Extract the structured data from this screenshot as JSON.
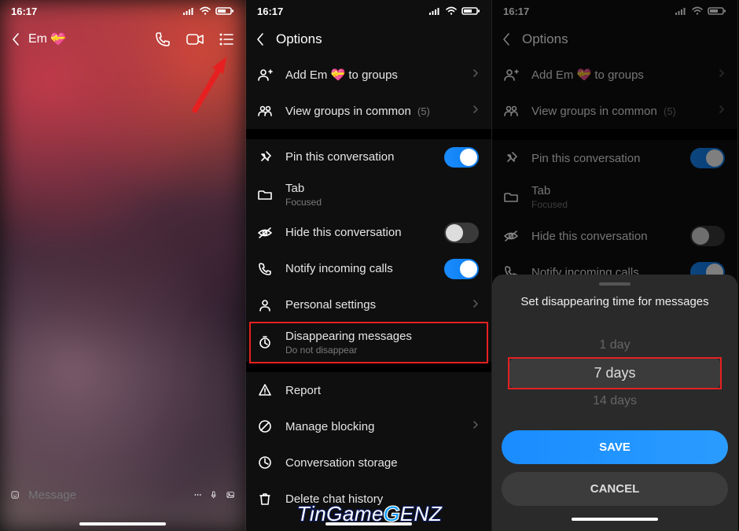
{
  "status": {
    "time": "16:17"
  },
  "chat": {
    "name": "Em",
    "emoji": "💝",
    "placeholder": "Message"
  },
  "options": {
    "title": "Options",
    "add_prefix": "Add ",
    "add_name": "Em",
    "add_emoji": "💝",
    "add_suffix": " to groups",
    "view_groups": "View groups in common",
    "view_groups_count": "(5)",
    "pin": "Pin this conversation",
    "tab": "Tab",
    "tab_sub": "Focused",
    "hide": "Hide this conversation",
    "notify": "Notify incoming calls",
    "personal": "Personal settings",
    "disappearing": "Disappearing messages",
    "disappearing_sub": "Do not disappear",
    "report": "Report",
    "manage_blocking": "Manage blocking",
    "conv_storage": "Conversation storage",
    "delete_history": "Delete chat history"
  },
  "sheet": {
    "title": "Set disappearing time for messages",
    "opt0": "",
    "opt1": "1 day",
    "opt2": "7 days",
    "opt3": "14 days",
    "save": "SAVE",
    "cancel": "CANCEL"
  },
  "watermark": {
    "t1": "TinGame",
    "g": "G",
    "t2": "ENZ"
  }
}
